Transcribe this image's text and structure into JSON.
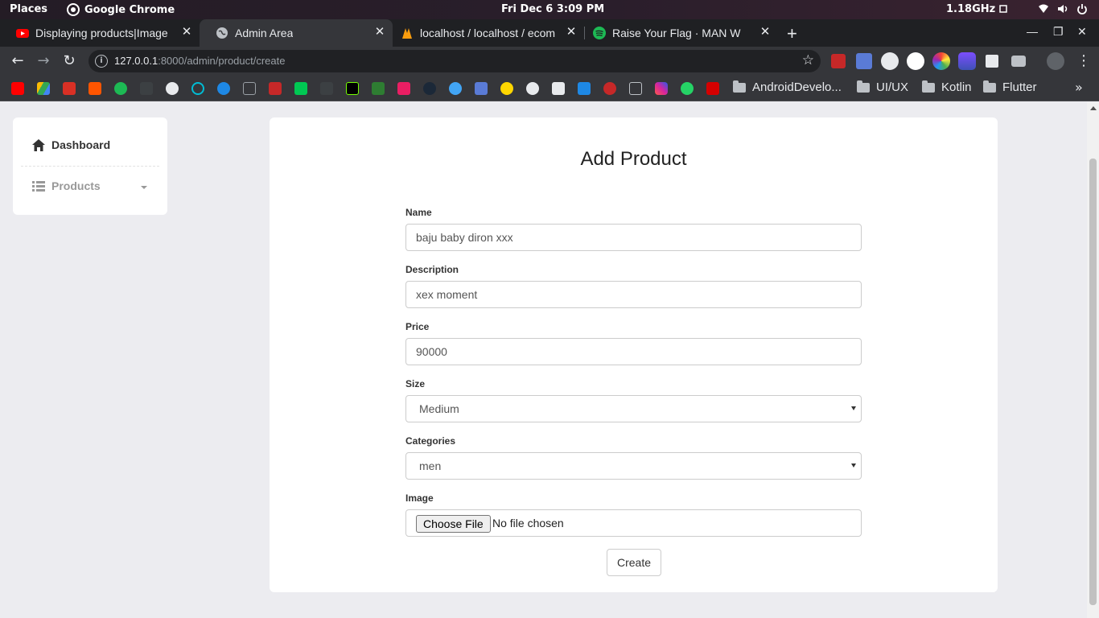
{
  "os_bar": {
    "places": "Places",
    "app_name": "Google Chrome",
    "clock": "Fri Dec 6  3:09 PM",
    "cpu": "1.18GHz"
  },
  "tabs": [
    {
      "title": "Displaying products|Image",
      "favicon": "youtube-icon",
      "active": false
    },
    {
      "title": "Admin Area",
      "favicon": "globe-icon",
      "active": true
    },
    {
      "title": "localhost / localhost / ecom",
      "favicon": "phpmyadmin-icon",
      "active": false
    },
    {
      "title": "Raise Your Flag · MAN W",
      "favicon": "spotify-icon",
      "active": false
    }
  ],
  "address_bar": {
    "host": "127.0.0.1",
    "path": ":8000/admin/product/create"
  },
  "bookmark_folders": [
    "AndroidDevelo...",
    "UI/UX",
    "Kotlin",
    "Flutter"
  ],
  "sidebar": {
    "dashboard": "Dashboard",
    "products": "Products"
  },
  "form": {
    "title": "Add Product",
    "name_label": "Name",
    "name_value": "baju baby diron xxx",
    "description_label": "Description",
    "description_value": "xex moment",
    "price_label": "Price",
    "price_value": "90000",
    "size_label": "Size",
    "size_value": "Medium",
    "categories_label": "Categories",
    "categories_value": "men",
    "image_label": "Image",
    "choose_file": "Choose File",
    "no_file": "No file chosen",
    "submit": "Create"
  },
  "colors": {
    "page_bg": "#ececf0",
    "chrome_dark": "#35363a",
    "tab_strip": "#1f2023"
  }
}
